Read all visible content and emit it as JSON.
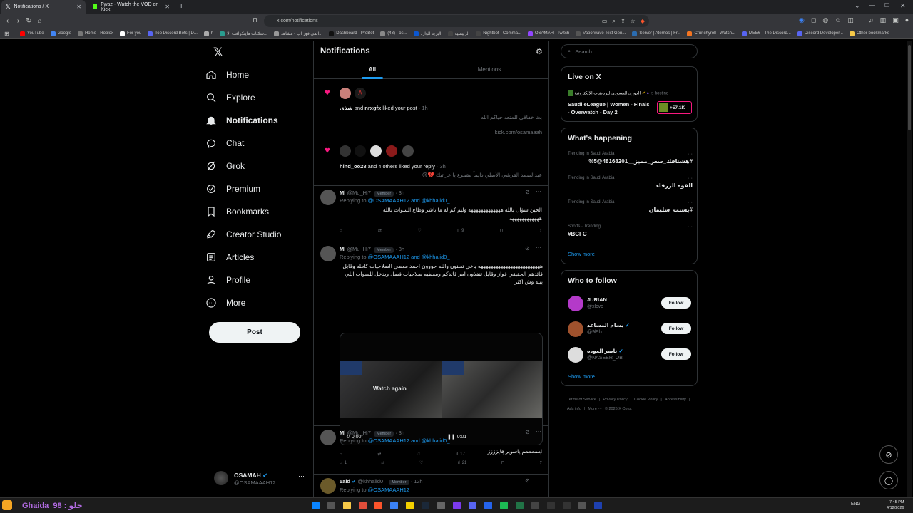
{
  "browser": {
    "tabs": [
      {
        "label": "Notifications / X"
      },
      {
        "label": "Fwaz - Watch the VOD on Kick"
      }
    ],
    "url": "x.com/notifications",
    "bookmarks": [
      "YouTube",
      "Google",
      "Home - Roblox",
      "For you",
      "Top Discord Bots | D...",
      "h",
      "سكنات مايتكرافت الا...",
      "انمي فور اب - مشاهد...",
      "Dashboard - ProBot",
      "(43) - os...",
      "البريد الوارد",
      "الرئيسية",
      "Nightbot - Comma...",
      "OSAMAH - Twitch",
      "Vaporwave Text Gen...",
      "Server | Aternos | Fr...",
      "Crunchyroll - Watch...",
      "MEE6 - The Discord...",
      "Discord Developer...",
      "Other bookmarks"
    ]
  },
  "nav": {
    "items": [
      {
        "label": "Home",
        "icon": "home-icon"
      },
      {
        "label": "Explore",
        "icon": "search-icon"
      },
      {
        "label": "Notifications",
        "icon": "bell-icon"
      },
      {
        "label": "Chat",
        "icon": "chat-icon"
      },
      {
        "label": "Grok",
        "icon": "grok-icon"
      },
      {
        "label": "Premium",
        "icon": "premium-icon"
      },
      {
        "label": "Bookmarks",
        "icon": "bookmark-icon"
      },
      {
        "label": "Creator Studio",
        "icon": "rocket-icon"
      },
      {
        "label": "Articles",
        "icon": "articles-icon"
      },
      {
        "label": "Profile",
        "icon": "person-icon"
      },
      {
        "label": "More",
        "icon": "more-icon"
      }
    ],
    "post_label": "Post",
    "account": {
      "name": "OSAMAH",
      "handle": "@OSAMAAAH12"
    }
  },
  "main": {
    "title": "Notifications",
    "tabs": [
      "All",
      "Mentions"
    ],
    "n1": {
      "names": "شذى",
      "and": "and",
      "name2": "nrxgfx",
      "action": "liked your post",
      "time": "· 1h",
      "text1": "بث خفافي للمتعه حياكم الله",
      "text2": "kick.com/osamaaah"
    },
    "n2": {
      "name": "hind_oo28",
      "rest": "and 4 others liked your reply",
      "time": "· 3h",
      "text": "عبدالصمد القرشي الأصلي دايماً مقموع يا عزاتيك 💔😢"
    },
    "p1": {
      "name": "Ml",
      "handle": "@Mu_Hi7",
      "badge": "Member",
      "time": "· 3h",
      "reply_prefix": "Replying to",
      "reply_to": "@OSAMAAAH12 and @khhalid0_",
      "text": "الحين سؤال بالله هههههههههههههه وليم كم له ما باشر وطاع السوات بالله ههههههههههههه",
      "views": "9"
    },
    "p2": {
      "name": "Ml",
      "handle": "@Mu_Hi7",
      "badge": "Member",
      "time": "· 3h",
      "reply_prefix": "Replying to",
      "reply_to": "@OSAMAAAH12 and @khhalid0_",
      "text": "هههههههههههههههههههههههههه ياخي تعبنون والله حووون احمد معطي الصلاحيات كامله وقايل قائدهم الحقيقي فواز وقايل تنفذون امر قائدكم ومعطيه صلاحيات فصل ويدخل للسوات اللي يبيه وش اكثر",
      "watch": "Watch again",
      "t1": "0:00",
      "t2": "0:01",
      "views": "17"
    },
    "p3": {
      "name": "Ml",
      "handle": "@Mu_Hi7",
      "badge": "Member",
      "time": "· 3h",
      "reply_prefix": "Replying to",
      "reply_to": "@OSAMAAAH12 and @khhalid0_",
      "text": "امممممم ياسوير فايزززز",
      "replies": "1",
      "views": "21"
    },
    "p4": {
      "name": "5ald",
      "handle": "@khhalid0_",
      "badge": "Member",
      "time": "· 12h",
      "reply_prefix": "Replying to",
      "reply_to": "@OSAMAAAH12"
    }
  },
  "right": {
    "search_placeholder": "Search",
    "live": {
      "title": "Live on X",
      "host": "الدوري السعودي للرياضات الإلكترونية",
      "hosting": "is hosting",
      "event": "Saudi eLeague | Women - Finals - Overwatch - Day 2",
      "count": "+57.1K"
    },
    "happening": {
      "title": "What's happening",
      "trends": [
        {
          "meta": "Trending in Saudi Arabia",
          "name": "#هشنافك_سعر_مميز__48168201@5%"
        },
        {
          "meta": "Trending in Saudi Arabia",
          "name": "القوه الزرقاء"
        },
        {
          "meta": "Trending in Saudi Arabia",
          "name": "#بسنت_سليمان"
        },
        {
          "meta": "Sports · Trending",
          "name": "#BCFC"
        }
      ],
      "show_more": "Show more"
    },
    "follow": {
      "title": "Who to follow",
      "users": [
        {
          "name": "JURIAN",
          "handle": "@xlcvo"
        },
        {
          "name": "بسام المساعد",
          "handle": "@9l9lx"
        },
        {
          "name": "ناصر العوده",
          "handle": "@NASEER_OB"
        }
      ],
      "button": "Follow",
      "show_more": "Show more"
    },
    "footer": [
      "Terms of Service",
      "|",
      "Privacy Policy",
      "|",
      "Cookie Policy",
      "|",
      "Accessibility",
      "|",
      "Ads info",
      "|",
      "More ···",
      "© 2026 X Corp."
    ]
  },
  "taskbar": {
    "overlay": "Ghaida_98 : حلو",
    "lang": "ENG",
    "time": "7:45 PM",
    "date": "4/12/2026"
  },
  "colors": {
    "accent": "#1d9bf0",
    "like": "#f91880",
    "bg": "#000000",
    "border": "#2f3336"
  }
}
